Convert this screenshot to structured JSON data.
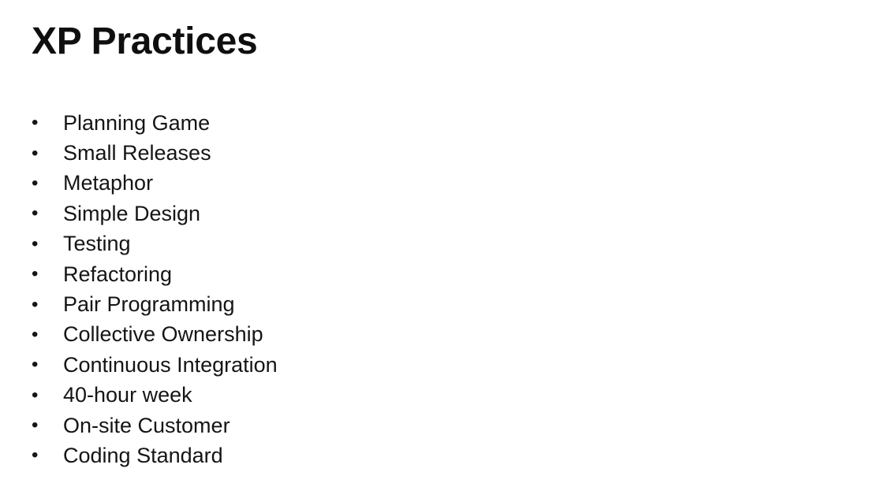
{
  "slide": {
    "title": "XP Practices",
    "bullet_glyph": "•",
    "items": [
      "Planning Game",
      "Small Releases",
      "Metaphor",
      "Simple Design",
      "Testing",
      "Refactoring",
      "Pair Programming",
      "Collective Ownership",
      "Continuous Integration",
      "40-hour week",
      "On-site Customer",
      "Coding Standard"
    ]
  }
}
